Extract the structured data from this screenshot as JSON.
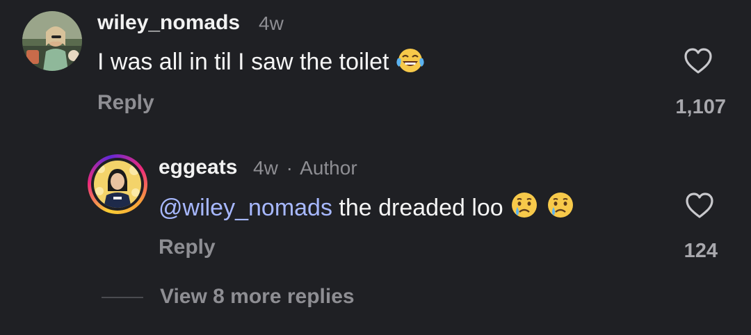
{
  "comment": {
    "username": "wiley_nomads",
    "time": "4w",
    "text": "I was all in til I saw the toilet",
    "emoji_icon": "face-with-tears-of-joy",
    "reply_label": "Reply",
    "like_count": "1,107"
  },
  "reply": {
    "username": "eggeats",
    "time": "4w",
    "separator": "·",
    "author_badge": "Author",
    "mention": "@wiley_nomads",
    "text": " the dreaded loo",
    "emoji_icons": [
      "crying-face",
      "crying-face"
    ],
    "reply_label": "Reply",
    "like_count": "124"
  },
  "view_more_label": "View 8 more replies",
  "colors": {
    "background": "#1f2024",
    "mention": "#a7b8ff",
    "muted": "#8e8e93"
  }
}
